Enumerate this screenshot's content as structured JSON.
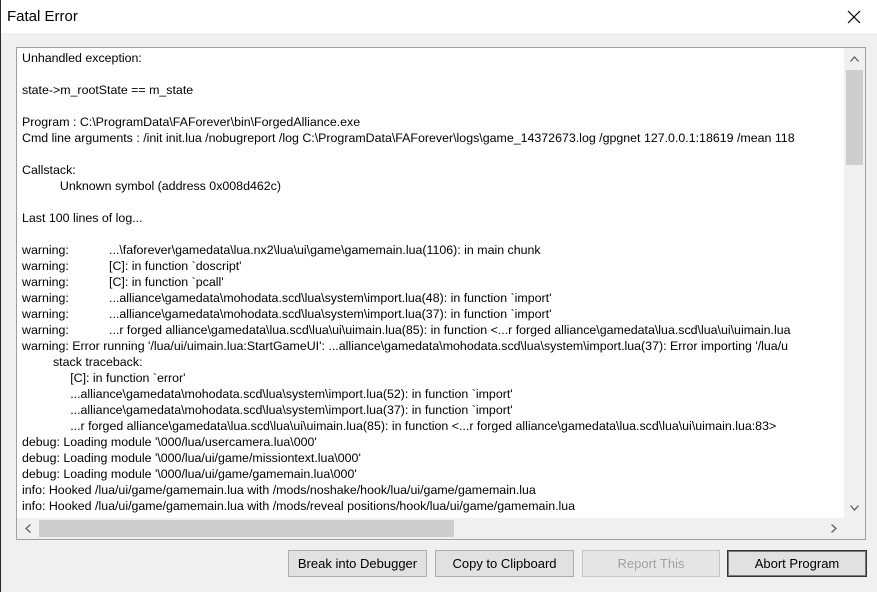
{
  "window": {
    "title": "Fatal Error"
  },
  "log": {
    "lines": [
      {
        "a": "Unhandled exception:",
        "b": ""
      },
      {
        "a": "",
        "b": ""
      },
      {
        "a": "state->m_rootState == m_state",
        "b": ""
      },
      {
        "a": "",
        "b": ""
      },
      {
        "a": "Program : C:\\ProgramData\\FAForever\\bin\\ForgedAlliance.exe",
        "b": ""
      },
      {
        "a": "Cmd line arguments : /init init.lua /nobugreport /log C:\\ProgramData\\FAForever\\logs\\game_14372673.log /gpgnet 127.0.0.1:18619 /mean 118",
        "b": ""
      },
      {
        "a": "",
        "b": ""
      },
      {
        "a": "Callstack:",
        "b": ""
      },
      {
        "a": "           Unknown symbol (address 0x008d462c)",
        "b": ""
      },
      {
        "a": "",
        "b": ""
      },
      {
        "a": "Last 100 lines of log...",
        "b": ""
      },
      {
        "a": "",
        "b": ""
      },
      {
        "a": "warning:",
        "b": "...\\faforever\\gamedata\\lua.nx2\\lua\\ui\\game\\gamemain.lua(1106): in main chunk"
      },
      {
        "a": "warning:",
        "b": "[C]: in function `doscript'"
      },
      {
        "a": "warning:",
        "b": "[C]: in function `pcall'"
      },
      {
        "a": "warning:",
        "b": "...alliance\\gamedata\\mohodata.scd\\lua\\system\\import.lua(48): in function `import'"
      },
      {
        "a": "warning:",
        "b": "...alliance\\gamedata\\mohodata.scd\\lua\\system\\import.lua(37): in function `import'"
      },
      {
        "a": "warning:",
        "b": "...r forged alliance\\gamedata\\lua.scd\\lua\\ui\\uimain.lua(85): in function <...r forged alliance\\gamedata\\lua.scd\\lua\\ui\\uimain.lua"
      },
      {
        "a": "warning: Error running '/lua/ui/uimain.lua:StartGameUI': ...alliance\\gamedata\\mohodata.scd\\lua\\system\\import.lua(37): Error importing '/lua/u",
        "b": ""
      },
      {
        "a": "         stack traceback:",
        "b": ""
      },
      {
        "a": "              [C]: in function `error'",
        "b": ""
      },
      {
        "a": "              ...alliance\\gamedata\\mohodata.scd\\lua\\system\\import.lua(52): in function `import'",
        "b": ""
      },
      {
        "a": "              ...alliance\\gamedata\\mohodata.scd\\lua\\system\\import.lua(37): in function `import'",
        "b": ""
      },
      {
        "a": "              ...r forged alliance\\gamedata\\lua.scd\\lua\\ui\\uimain.lua(85): in function <...r forged alliance\\gamedata\\lua.scd\\lua\\ui\\uimain.lua:83>",
        "b": ""
      },
      {
        "a": "debug: Loading module '\\000/lua/usercamera.lua\\000'",
        "b": ""
      },
      {
        "a": "debug: Loading module '\\000/lua/ui/game/missiontext.lua\\000'",
        "b": ""
      },
      {
        "a": "debug: Loading module '\\000/lua/ui/game/gamemain.lua\\000'",
        "b": ""
      },
      {
        "a": "info: Hooked /lua/ui/game/gamemain.lua with /mods/noshake/hook/lua/ui/game/gamemain.lua",
        "b": ""
      },
      {
        "a": "info: Hooked /lua/ui/game/gamemain.lua with /mods/reveal positions/hook/lua/ui/game/gamemain.lua",
        "b": ""
      }
    ]
  },
  "buttons": {
    "break": "Break into Debugger",
    "copy": "Copy to Clipboard",
    "report": "Report This",
    "abort": "Abort Program"
  }
}
